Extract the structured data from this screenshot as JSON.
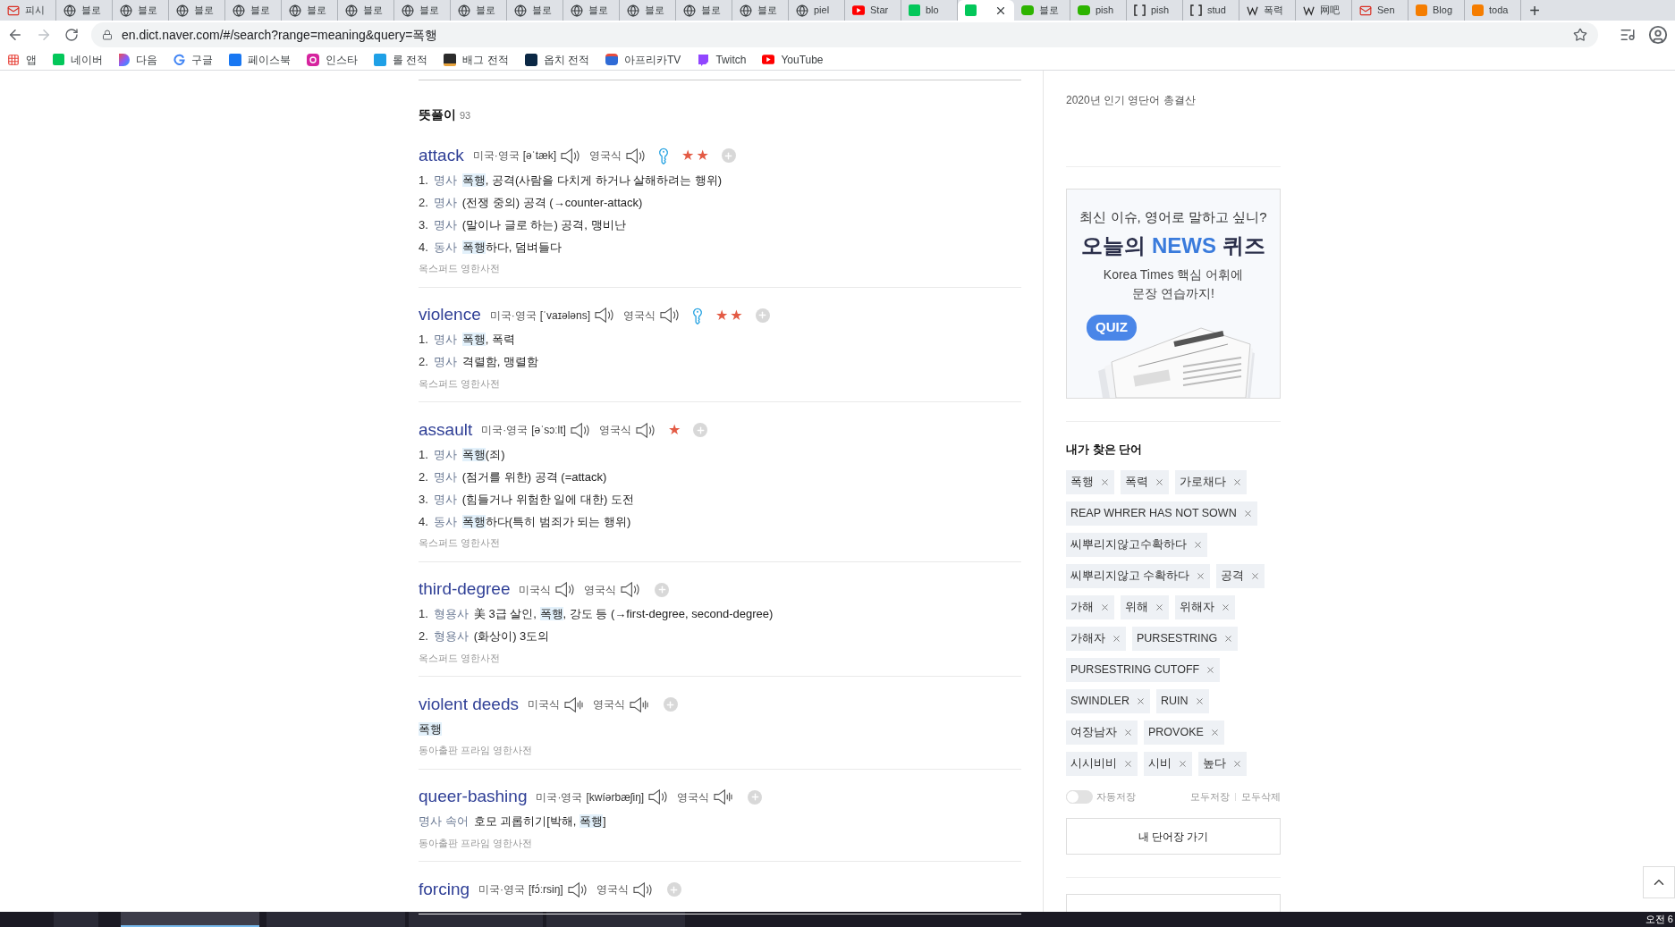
{
  "browser": {
    "tabs": [
      {
        "title": "피시",
        "kind": "mail",
        "selected": false
      },
      {
        "title": "블로",
        "kind": "globe",
        "selected": false
      },
      {
        "title": "블로",
        "kind": "globe",
        "selected": false
      },
      {
        "title": "블로",
        "kind": "globe",
        "selected": false
      },
      {
        "title": "블로",
        "kind": "globe",
        "selected": false
      },
      {
        "title": "블로",
        "kind": "globe",
        "selected": false
      },
      {
        "title": "블로",
        "kind": "globe",
        "selected": false
      },
      {
        "title": "블로",
        "kind": "globe",
        "selected": false
      },
      {
        "title": "블로",
        "kind": "globe",
        "selected": false
      },
      {
        "title": "블로",
        "kind": "globe",
        "selected": false
      },
      {
        "title": "블로",
        "kind": "globe",
        "selected": false
      },
      {
        "title": "블로",
        "kind": "globe",
        "selected": false
      },
      {
        "title": "블로",
        "kind": "globe",
        "selected": false
      },
      {
        "title": "블로",
        "kind": "globe",
        "selected": false
      },
      {
        "title": "piel",
        "kind": "globe",
        "selected": false
      },
      {
        "title": "Star",
        "kind": "video",
        "selected": false
      },
      {
        "title": "blo",
        "kind": "green",
        "selected": false
      },
      {
        "kind": "green",
        "selected": true
      },
      {
        "title": "블로",
        "kind": "blog",
        "selected": false
      },
      {
        "title": "pish",
        "kind": "blog",
        "selected": false
      },
      {
        "title": "pish",
        "kind": "bracket",
        "selected": false
      },
      {
        "title": "stud",
        "kind": "bracket",
        "selected": false
      },
      {
        "title": "폭력",
        "kind": "wiki",
        "selected": false
      },
      {
        "title": "网吧",
        "kind": "wiki",
        "selected": false
      },
      {
        "title": "Sen",
        "kind": "mail",
        "selected": false
      },
      {
        "title": "Blog",
        "kind": "orange",
        "selected": false
      },
      {
        "title": "toda",
        "kind": "orange",
        "selected": false
      }
    ],
    "new_tab": "+",
    "url": "en.dict.naver.com/#/search?range=meaning&query=폭행",
    "bookmarks": [
      {
        "label": "앱",
        "kind": "apps"
      },
      {
        "label": "네이버",
        "kind": "green"
      },
      {
        "label": "다음",
        "kind": "daum"
      },
      {
        "label": "구글",
        "kind": "google"
      },
      {
        "label": "페이스북",
        "kind": "facebook"
      },
      {
        "label": "인스타",
        "kind": "instagram"
      },
      {
        "label": "롤 전적",
        "kind": "sky"
      },
      {
        "label": "배그 전적",
        "kind": "dark"
      },
      {
        "label": "옵치 전적",
        "kind": "navy"
      },
      {
        "label": "아프리카TV",
        "kind": "tv"
      },
      {
        "label": "Twitch",
        "kind": "twitch"
      },
      {
        "label": "YouTube",
        "kind": "video"
      }
    ]
  },
  "results": {
    "title": "뜻풀이",
    "count": "93",
    "entries": [
      {
        "word": "attack",
        "pron": [
          {
            "label": "미국·영국",
            "ipa": "[əˈtæk]",
            "kind": "wave"
          },
          {
            "label": "영국식",
            "kind": "wave"
          }
        ],
        "key": true,
        "importance": "★★",
        "meanings": [
          {
            "num": "1.",
            "pos": "명사",
            "text": "**폭행**, 공격(사람을 다치게 하거나 살해하려는 행위)"
          },
          {
            "num": "2.",
            "pos": "명사",
            "text": "(전쟁 중의) 공격 (→counter-attack)"
          },
          {
            "num": "3.",
            "pos": "명사",
            "text": "(말이나 글로 하는) 공격, 맹비난"
          },
          {
            "num": "4.",
            "pos": "동사",
            "text": "**폭행**하다, 덤벼들다"
          }
        ],
        "source": "옥스퍼드 영한사전"
      },
      {
        "word": "violence",
        "pron": [
          {
            "label": "미국·영국",
            "ipa": "[ˈvaɪələns]",
            "kind": "wave"
          },
          {
            "label": "영국식",
            "kind": "wave"
          }
        ],
        "key": true,
        "importance": "★★",
        "meanings": [
          {
            "num": "1.",
            "pos": "명사",
            "text": "**폭행**, 폭력"
          },
          {
            "num": "2.",
            "pos": "명사",
            "text": "격렬함, 맹렬함"
          }
        ],
        "source": "옥스퍼드 영한사전"
      },
      {
        "word": "assault",
        "pron": [
          {
            "label": "미국·영국",
            "ipa": "[əˈsɔːlt]",
            "kind": "wave"
          },
          {
            "label": "영국식",
            "kind": "wave"
          }
        ],
        "key": false,
        "importance": "★",
        "meanings": [
          {
            "num": "1.",
            "pos": "명사",
            "text": "**폭행**(죄)"
          },
          {
            "num": "2.",
            "pos": "명사",
            "text": "(점거를 위한) 공격 (=attack)"
          },
          {
            "num": "3.",
            "pos": "명사",
            "text": "(힘들거나 위험한 일에 대한) 도전"
          },
          {
            "num": "4.",
            "pos": "동사",
            "text": "**폭행**하다(특히 범죄가 되는 행위)"
          }
        ],
        "source": "옥스퍼드 영한사전"
      },
      {
        "word": "third-degree",
        "pron": [
          {
            "label": "미국식",
            "kind": "wave"
          },
          {
            "label": "영국식",
            "kind": "wave"
          }
        ],
        "key": false,
        "meanings": [
          {
            "num": "1.",
            "pos": "형용사",
            "text": "美 3급 살인, **폭행**, 강도 등 (→first-degree, second-degree)"
          },
          {
            "num": "2.",
            "pos": "형용사",
            "text": "(화상이) 3도의"
          }
        ],
        "source": "옥스퍼드 영한사전"
      },
      {
        "word": "violent deeds",
        "pron": [
          {
            "label": "미국식",
            "kind": "bars"
          },
          {
            "label": "영국식",
            "kind": "bars"
          }
        ],
        "key": false,
        "meanings": [
          {
            "text": "**폭행**"
          }
        ],
        "source": "동아출판 프라임 영한사전"
      },
      {
        "word": "queer-bashing",
        "pron": [
          {
            "label": "미국·영국",
            "ipa": "[kwíərbæʃiŋ]",
            "kind": "wave"
          },
          {
            "label": "영국식",
            "kind": "bars"
          }
        ],
        "key": false,
        "meanings": [
          {
            "pos": "명사 속어",
            "text": "호모 괴롭히기[박해, **폭행**]"
          }
        ],
        "source": "동아출판 프라임 영한사전"
      },
      {
        "word": "forcing",
        "pron": [
          {
            "label": "미국·영국",
            "ipa": "[fɔ́ːrsiŋ]",
            "kind": "wave"
          },
          {
            "label": "영국식",
            "kind": "wave"
          }
        ],
        "key": false
      }
    ]
  },
  "sidebar": {
    "link": "2020년 인기 영단어 총결산",
    "ad": {
      "line1": "최신 이슈, 영어로 말하고 싶니?",
      "title_start": "오늘의",
      "title_accent": "NEWS",
      "title_end": "퀴즈",
      "line3": "Korea Times 핵심 어휘에",
      "line4": "문장 연습까지!",
      "bubble": "QUIZ"
    },
    "history": {
      "title": "내가 찾은 단어",
      "words": [
        "폭행",
        "폭력",
        "가로채다",
        "REAP WHRER HAS NOT SOWN",
        "씨뿌리지않고수확하다",
        "씨뿌리지않고 수확하다",
        "공격",
        "가해",
        "위해",
        "위해자",
        "가해자",
        "PURSESTRING",
        "PURSESTRING CUTOFF",
        "SWINDLER",
        "RUIN",
        "여장남자",
        "PROVOKE",
        "시시비비",
        "시비",
        "높다"
      ],
      "autosave": {
        "label": "자동저장",
        "on": false
      },
      "save_all": "모두저장",
      "delete_all": "모두삭제",
      "button": "내 단어장 가기"
    }
  },
  "taskbar": {
    "time": "오전 6"
  }
}
